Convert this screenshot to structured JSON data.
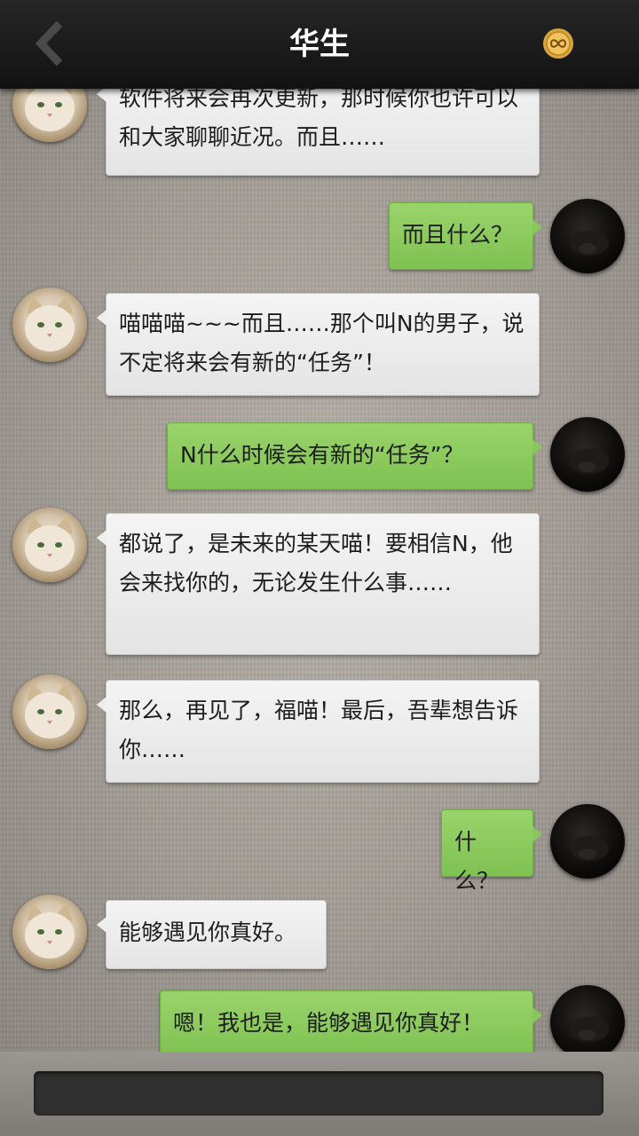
{
  "header": {
    "title": "华生",
    "back_icon": "chevron-left-icon",
    "badge_icon": "infinity-badge-icon",
    "badge_color": "#d9a53a"
  },
  "messages": [
    {
      "side": "in",
      "text": "软件将来会再次更新，那时候你也许可以和大家聊聊近况。而且……"
    },
    {
      "side": "out",
      "text": "而且什么？"
    },
    {
      "side": "in",
      "text": "喵喵喵~~~而且……那个叫N的男子，说不定将来会有新的“任务”！"
    },
    {
      "side": "out",
      "text": "N什么时候会有新的“任务”？"
    },
    {
      "side": "in",
      "text": "都说了，是未来的某天喵！要相信N，他会来找你的，无论发生什么事……"
    },
    {
      "side": "in",
      "text": "那么，再见了，福喵！最后，吾辈想告诉你……"
    },
    {
      "side": "out",
      "text": "什么？"
    },
    {
      "side": "in",
      "text": "能够遇见你真好。"
    },
    {
      "side": "out",
      "text": "嗯！我也是，能够遇见你真好！"
    }
  ],
  "input": {
    "value": "",
    "placeholder": ""
  },
  "colors": {
    "outgoing_bubble": "#8cca5e",
    "incoming_bubble": "#eeeeee",
    "header_bg": "#1c1c1c"
  }
}
